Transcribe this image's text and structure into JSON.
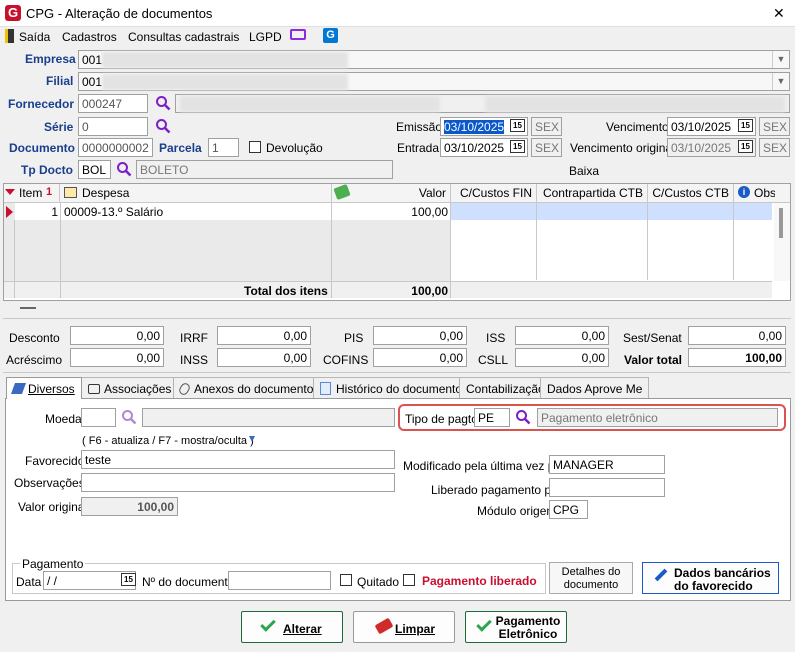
{
  "window": {
    "title": "CPG - Alteração de documentos",
    "close": "✕"
  },
  "menu": {
    "exit": "Saída",
    "cadastros": "Cadastros",
    "consultas": "Consultas cadastrais",
    "lgpd": "LGPD"
  },
  "header": {
    "empresa_label": "Empresa",
    "empresa_value": "001",
    "filial_label": "Filial",
    "filial_value": "001",
    "fornecedor_label": "Fornecedor",
    "fornecedor_value": "000247",
    "serie_label": "Série",
    "serie_value": "0",
    "documento_label": "Documento",
    "documento_value": "0000000002",
    "parcela_label": "Parcela",
    "parcela_value": "1",
    "devolucao_label": "Devolução",
    "tpdocto_label": "Tp Docto",
    "tpdocto_value": "BOL",
    "tpdocto_desc": "BOLETO",
    "emissao_label": "Emissão",
    "emissao_value": "03/10/2025",
    "emissao_day": "SEX",
    "entrada_label": "Entrada",
    "entrada_value": "03/10/2025",
    "entrada_day": "SEX",
    "vencimento_label": "Vencimento",
    "vencimento_value": "03/10/2025",
    "vencimento_day": "SEX",
    "venc_original_label": "Vencimento original",
    "venc_original_value": "03/10/2025",
    "venc_original_day": "SEX",
    "baixa_label": "Baixa"
  },
  "grid": {
    "columns": [
      "Item",
      "Despesa",
      "Valor",
      "C/Custos FIN",
      "Contrapartida CTB",
      "C/Custos CTB",
      "Obs"
    ],
    "rows": [
      {
        "item": "1",
        "despesa": "00009-13.º Salário",
        "valor": "100,00"
      }
    ],
    "total_label": "Total dos itens",
    "total_value": "100,00"
  },
  "totals": {
    "desconto_label": "Desconto",
    "desconto": "0,00",
    "irrf_label": "IRRF",
    "irrf": "0,00",
    "pis_label": "PIS",
    "pis": "0,00",
    "iss_label": "ISS",
    "iss": "0,00",
    "sest_label": "Sest/Senat",
    "sest": "0,00",
    "acrescimo_label": "Acréscimo",
    "acrescimo": "0,00",
    "inss_label": "INSS",
    "inss": "0,00",
    "cofins_label": "COFINS",
    "cofins": "0,00",
    "csll_label": "CSLL",
    "csll": "0,00",
    "valor_total_label": "Valor total",
    "valor_total": "100,00"
  },
  "tabs": [
    "Diversos",
    "Associações",
    "Anexos do documento",
    "Histórico do documento",
    "Contabilização",
    "Dados Aprove Me"
  ],
  "diversos": {
    "moeda_label": "Moeda",
    "moeda_value": "",
    "hint": "( F6 - atualiza / F7 - mostra/oculta )",
    "favorecido_label": "Favorecido",
    "favorecido_value": "teste",
    "observacoes_label": "Observações",
    "observacoes_value": "",
    "valor_original_label": "Valor original",
    "valor_original_value": "100,00",
    "tipo_pagto_label": "Tipo de pagto",
    "tipo_pagto_value": "PE",
    "tipo_pagto_desc": "Pagamento eletrônico",
    "modificado_label": "Modificado pela última vez por",
    "modificado_value": "MANAGER",
    "liberado_label": "Liberado pagamento por",
    "liberado_value": "",
    "modulo_label": "Módulo origem",
    "modulo_value": "CPG"
  },
  "pagamento": {
    "group_label": "Pagamento",
    "data_label": "Data",
    "data_value": " /  /",
    "ndoc_label": "Nº do documento",
    "ndoc_value": "",
    "quitado_label": "Quitado",
    "liberado_label": "Pagamento liberado",
    "detalhes_label": "Detalhes do documento",
    "dados_bancarios_label": "Dados bancários do favorecido"
  },
  "actions": {
    "alterar": "Alterar",
    "limpar": "Limpar",
    "pagamento_eletronico": "Pagamento Eletrônico"
  },
  "colors": {
    "accent_red": "#c8102e",
    "highlight": "#d9534f",
    "selection": "#0a58ca",
    "row_sel": "#cfe0ff"
  }
}
